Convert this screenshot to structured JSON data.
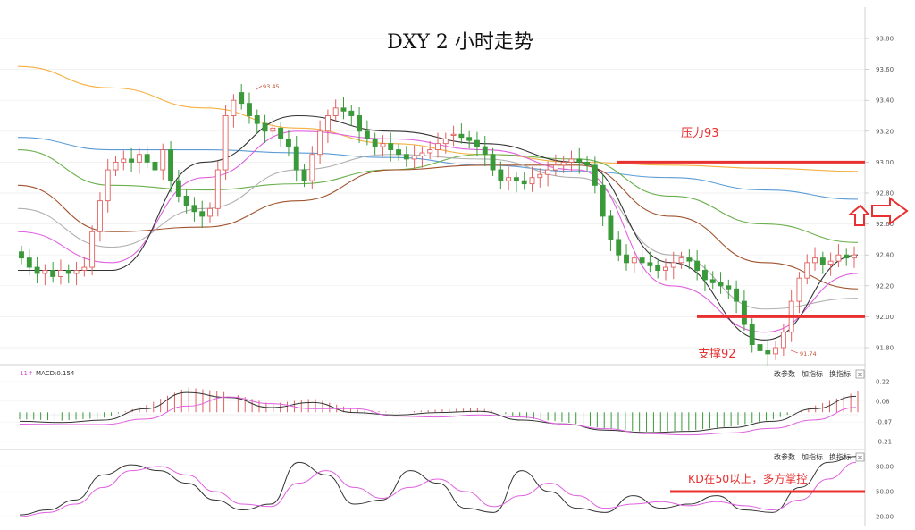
{
  "title": "DXY 2 小时走势",
  "colors": {
    "up": "#e26060",
    "down": "#3a9a3a",
    "annot": "#e83030",
    "ma_orange": "#f5b041",
    "ma_blue": "#5b9bd5",
    "ma_green": "#6ab04c",
    "ma_brown": "#a0522d",
    "ma_gray": "#b0b0b0",
    "ma_pink": "#e060e0",
    "ma_black": "#333333"
  },
  "price_axis": {
    "ticks": [
      "93.80",
      "93.60",
      "93.40",
      "93.20",
      "93.00",
      "92.80",
      "92.60",
      "92.40",
      "92.20",
      "92.00",
      "91.80"
    ]
  },
  "macd_axis": {
    "ticks": [
      "0.22",
      "0.08",
      "-0.07",
      "-0.21"
    ]
  },
  "kd_axis": {
    "ticks": [
      "80.00",
      "50.00",
      "20.00"
    ]
  },
  "annotations": {
    "resistance_label": "压力93",
    "support_label": "支撑92",
    "high_label": "93.45",
    "low_label": "91.74",
    "kd_label": "KD在50以上，多方掌控"
  },
  "macd_header": {
    "prefix": "11",
    "label": "MACD:0.154"
  },
  "panel_buttons": [
    "改参数",
    "加指标",
    "换指标"
  ],
  "close_icon": "×",
  "chart_data": {
    "type": "candlestick",
    "title": "DXY 2 小时走势",
    "price_range": [
      91.7,
      93.85
    ],
    "resistance": 93.0,
    "support": 92.0,
    "high": 93.45,
    "low": 91.74,
    "closes": [
      92.38,
      92.32,
      92.28,
      92.3,
      92.26,
      92.3,
      92.28,
      92.3,
      92.32,
      92.55,
      92.75,
      92.95,
      93.0,
      93.02,
      93.0,
      93.05,
      93.0,
      92.95,
      93.08,
      92.88,
      92.78,
      92.72,
      92.68,
      92.65,
      92.7,
      92.95,
      93.3,
      93.4,
      93.38,
      93.3,
      93.25,
      93.2,
      93.22,
      93.15,
      93.1,
      92.95,
      92.88,
      93.05,
      93.2,
      93.3,
      93.35,
      93.33,
      93.3,
      93.2,
      93.15,
      93.1,
      93.12,
      93.08,
      93.05,
      93.02,
      93.04,
      93.06,
      93.08,
      93.12,
      93.15,
      93.18,
      93.16,
      93.14,
      93.1,
      93.05,
      92.95,
      92.88,
      92.9,
      92.88,
      92.86,
      92.9,
      92.92,
      92.95,
      92.98,
      93.0,
      93.02,
      93.0,
      92.98,
      92.85,
      92.65,
      92.5,
      92.4,
      92.35,
      92.38,
      92.35,
      92.33,
      92.3,
      92.32,
      92.35,
      92.38,
      92.36,
      92.3,
      92.24,
      92.22,
      92.2,
      92.18,
      92.1,
      91.95,
      91.82,
      91.78,
      91.76,
      91.8,
      91.9,
      92.1,
      92.25,
      92.35,
      92.38,
      92.34,
      92.36,
      92.4,
      92.38,
      92.4
    ],
    "opens": [
      92.42,
      92.38,
      92.32,
      92.28,
      92.3,
      92.26,
      92.3,
      92.28,
      92.3,
      92.32,
      92.55,
      92.75,
      92.95,
      93.0,
      93.02,
      93.0,
      93.05,
      93.0,
      92.95,
      93.08,
      92.88,
      92.78,
      92.72,
      92.68,
      92.65,
      92.7,
      92.95,
      93.3,
      93.45,
      93.38,
      93.3,
      93.25,
      93.2,
      93.22,
      93.15,
      93.1,
      92.95,
      92.88,
      93.05,
      93.2,
      93.3,
      93.35,
      93.33,
      93.3,
      93.2,
      93.15,
      93.1,
      93.12,
      93.08,
      93.05,
      93.02,
      93.04,
      93.06,
      93.08,
      93.12,
      93.18,
      93.18,
      93.16,
      93.14,
      93.1,
      93.05,
      92.95,
      92.88,
      92.9,
      92.88,
      92.86,
      92.9,
      92.92,
      92.95,
      92.98,
      93.0,
      93.02,
      93.0,
      92.98,
      92.85,
      92.65,
      92.5,
      92.4,
      92.35,
      92.38,
      92.35,
      92.33,
      92.3,
      92.32,
      92.35,
      92.38,
      92.36,
      92.3,
      92.24,
      92.22,
      92.2,
      92.18,
      92.1,
      91.95,
      91.82,
      91.78,
      91.76,
      91.8,
      91.9,
      92.1,
      92.25,
      92.35,
      92.38,
      92.34,
      92.36,
      92.4,
      92.38
    ],
    "ma_lines": [
      {
        "color": "#f5b041",
        "values": [
          93.62,
          93.48,
          93.35,
          93.22,
          93.12,
          93.05,
          93.0,
          92.98,
          92.96,
          92.94
        ]
      },
      {
        "color": "#5b9bd5",
        "values": [
          93.16,
          93.08,
          93.08,
          93.06,
          93.03,
          92.98,
          92.94,
          92.9,
          92.82,
          92.76
        ]
      },
      {
        "color": "#6ab04c",
        "values": [
          93.08,
          92.85,
          92.82,
          92.86,
          92.95,
          93.05,
          93.02,
          92.78,
          92.6,
          92.48
        ]
      },
      {
        "color": "#a0522d",
        "values": [
          92.85,
          92.55,
          92.58,
          92.75,
          92.95,
          92.98,
          92.98,
          92.65,
          92.35,
          92.18
        ]
      },
      {
        "color": "#b0b0b0",
        "values": [
          92.7,
          92.45,
          92.7,
          92.95,
          93.05,
          93.02,
          92.9,
          92.4,
          92.05,
          92.12
        ]
      },
      {
        "color": "#e060e0",
        "values": [
          92.55,
          92.35,
          92.9,
          93.2,
          93.15,
          93.08,
          92.95,
          92.2,
          91.9,
          92.28
        ]
      },
      {
        "color": "#333333",
        "values": [
          92.3,
          92.3,
          93.0,
          93.3,
          93.2,
          93.12,
          93.0,
          92.35,
          91.85,
          92.4
        ]
      }
    ],
    "macd_values": [
      -0.05,
      -0.06,
      -0.04,
      0.05,
      0.18,
      0.14,
      0.06,
      0.1,
      0.02,
      0.0,
      0.02,
      0.03,
      -0.04,
      -0.07,
      -0.12,
      -0.14,
      -0.13,
      -0.1,
      -0.05,
      0.05,
      0.15
    ],
    "kd_k": [
      22,
      28,
      40,
      70,
      82,
      75,
      60,
      40,
      28,
      35,
      85,
      70,
      35,
      40,
      75,
      60,
      30,
      25,
      75,
      50,
      30,
      25,
      45,
      30,
      35,
      45,
      28,
      25,
      55,
      85,
      92
    ],
    "kd_d": [
      20,
      25,
      35,
      55,
      75,
      80,
      70,
      50,
      35,
      32,
      60,
      75,
      55,
      42,
      55,
      65,
      50,
      32,
      45,
      60,
      45,
      30,
      35,
      38,
      33,
      38,
      33,
      28,
      40,
      65,
      85
    ]
  }
}
